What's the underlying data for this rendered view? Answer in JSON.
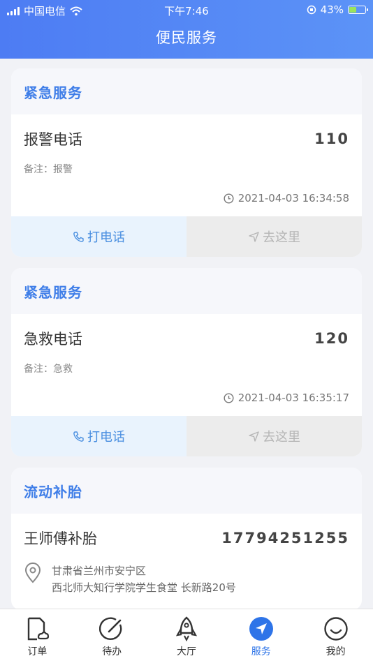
{
  "status_bar": {
    "carrier": "中国电信",
    "time": "下午7:46",
    "battery": "43%"
  },
  "nav": {
    "title": "便民服务"
  },
  "cards": [
    {
      "category": "紧急服务",
      "name": "报警电话",
      "number": "110",
      "note": "备注：报警",
      "time": "2021-04-03 16:34:58",
      "call_label": "打电话",
      "go_label": "去这里"
    },
    {
      "category": "紧急服务",
      "name": "急救电话",
      "number": "120",
      "note": "备注：急救",
      "time": "2021-04-03 16:35:17",
      "call_label": "打电话",
      "go_label": "去这里"
    },
    {
      "category": "流动补胎",
      "name": "王师傅补胎",
      "number": "17794251255",
      "address_line1": "甘肃省兰州市安宁区",
      "address_line2": "西北师大知行学院学生食堂 长新路20号"
    }
  ],
  "tabs": [
    {
      "label": "订单",
      "icon": "order-icon"
    },
    {
      "label": "待办",
      "icon": "todo-icon"
    },
    {
      "label": "大厅",
      "icon": "rocket-icon"
    },
    {
      "label": "服务",
      "icon": "navigation-icon",
      "active": true
    },
    {
      "label": "我的",
      "icon": "smile-icon"
    }
  ],
  "colors": {
    "header": "#4d7cf3",
    "accent": "#3f7ee8",
    "call_bg": "#e9f3fd"
  }
}
